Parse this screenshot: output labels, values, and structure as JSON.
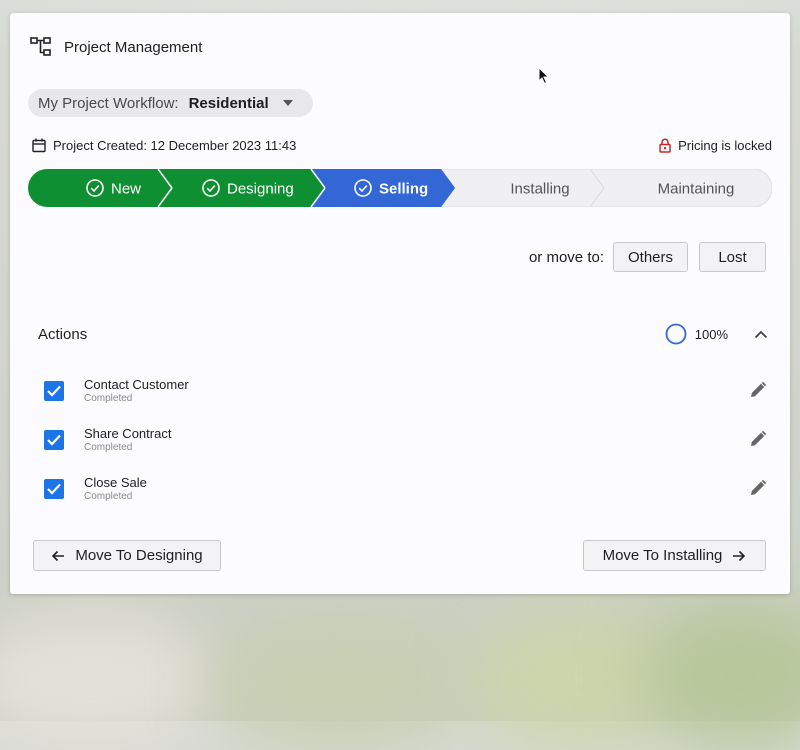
{
  "app": {
    "title": "Project Management",
    "icon": "hierarchy-icon"
  },
  "workflow": {
    "label": "My Project Workflow:",
    "value": "Residential"
  },
  "meta": {
    "created": "Project Created: 12 December 2023 11:43",
    "pricing": "Pricing is locked",
    "lock_color": "#c62828"
  },
  "stages": [
    {
      "label": "New",
      "status": "done"
    },
    {
      "label": "Designing",
      "status": "done"
    },
    {
      "label": "Selling",
      "status": "current"
    },
    {
      "label": "Installing",
      "status": "upcoming"
    },
    {
      "label": "Maintaining",
      "status": "upcoming"
    }
  ],
  "colors": {
    "done": "#0e9032",
    "current": "#3367d6",
    "upcoming": "#f0f0f2",
    "checkbox": "#1b74e8"
  },
  "move": {
    "label": "or move to:",
    "others": "Others",
    "lost": "Lost"
  },
  "actions": {
    "title": "Actions",
    "progress": "100%",
    "progress_value": 1.0,
    "items": [
      {
        "name": "Contact Customer",
        "status": "Completed",
        "checked": true
      },
      {
        "name": "Share Contract",
        "status": "Completed",
        "checked": true
      },
      {
        "name": "Close Sale",
        "status": "Completed",
        "checked": true
      }
    ]
  },
  "nav": {
    "prev": "Move To Designing",
    "next": "Move To Installing"
  }
}
